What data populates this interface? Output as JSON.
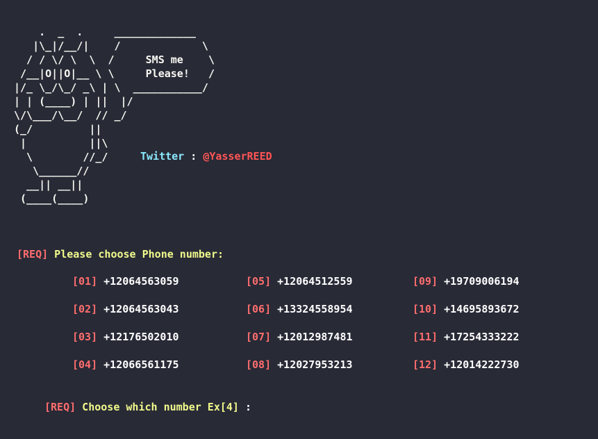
{
  "ascii_art": [
    "    .  _  .     _____________",
    "   |\\_|/__/|    /             \\",
    "  / / \\/ \\  \\  /     SMS me    \\",
    " /__|O||O|__ \\ \\     Please!   /",
    "|/_ \\_/\\_/ _\\ | \\  ___________/",
    "| | (____) | ||  |/",
    "\\/\\___/\\__/  // _/",
    "(_/         ||",
    " |          ||\\",
    "  \\        //_/",
    "   \\______//",
    "  __|| __||",
    " (____(____)"
  ],
  "twitter": {
    "label": "Twitter",
    "separator": " : ",
    "handle": "@YasserREED"
  },
  "prompt_choose": {
    "tag": "[REQ]",
    "text": " Please choose Phone number:"
  },
  "phones": [
    {
      "idx": "01",
      "number": "+12064563059"
    },
    {
      "idx": "02",
      "number": "+12064563043"
    },
    {
      "idx": "03",
      "number": "+12176502010"
    },
    {
      "idx": "04",
      "number": "+12066561175"
    },
    {
      "idx": "05",
      "number": "+12064512559"
    },
    {
      "idx": "06",
      "number": "+13324558954"
    },
    {
      "idx": "07",
      "number": "+12012987481"
    },
    {
      "idx": "08",
      "number": "+12027953213"
    },
    {
      "idx": "09",
      "number": "+19709006194"
    },
    {
      "idx": "10",
      "number": "+14695893672"
    },
    {
      "idx": "11",
      "number": "+17254333222"
    },
    {
      "idx": "12",
      "number": "+12014222730"
    }
  ],
  "prompt_which": {
    "tag": "[REQ]",
    "text": " Choose which number Ex[4] ",
    "colon": ":"
  },
  "colors": {
    "background": "#282a36",
    "tag_red": "#ff6e6e",
    "prompt_yellow": "#f1fa8c",
    "twitter_cyan": "#8be9fd",
    "handle_red": "#ff5555"
  }
}
